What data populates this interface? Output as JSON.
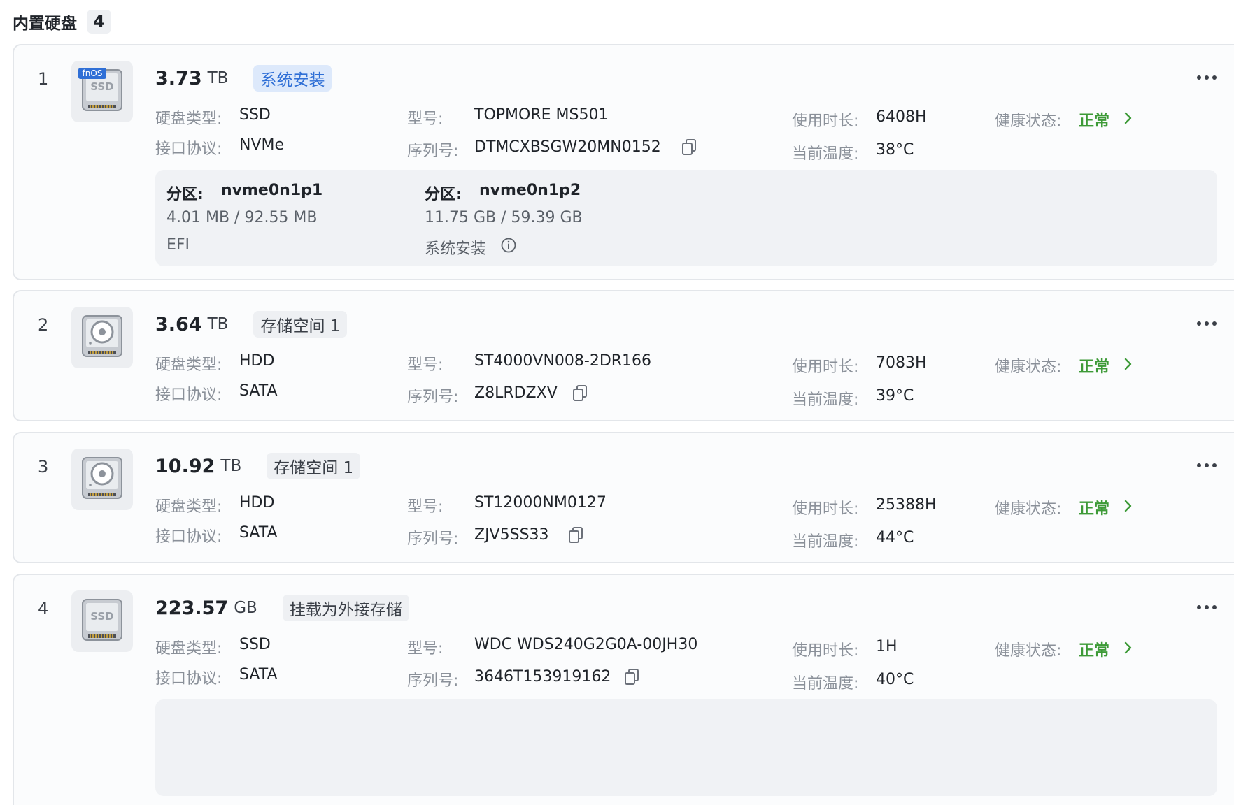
{
  "header": {
    "title": "内置硬盘",
    "count": "4"
  },
  "labels": {
    "type": "硬盘类型:",
    "protocol": "接口协议:",
    "model": "型号:",
    "serial": "序列号:",
    "usage": "使用时长:",
    "temp": "当前温度:",
    "health": "健康状态:",
    "partition": "分区:"
  },
  "colors": {
    "health_ok": "#3d9a37",
    "system_tag_bg": "#dde9fb",
    "system_tag_text": "#2f6fd6",
    "tag_bg": "#eef0f3"
  },
  "disks": [
    {
      "index": "1",
      "icon": "ssd-fnos-icon",
      "icon_ssd_text": "SSD",
      "icon_brand_text": "fnOS",
      "capacity": "3.73",
      "unit": "TB",
      "tag": "系统安装",
      "type": "SSD",
      "protocol": "NVMe",
      "model": "TOPMORE MS501",
      "serial": "DTMCXBSGW20MN0152",
      "usage": "6408H",
      "temp": "38°C",
      "health": "正常",
      "partitions": [
        {
          "name": "nvme0n1p1",
          "size": "4.01 MB / 92.55 MB",
          "role": "EFI"
        },
        {
          "name": "nvme0n1p2",
          "size": "11.75 GB / 59.39 GB",
          "role": "系统安装"
        }
      ]
    },
    {
      "index": "2",
      "icon": "hdd-icon",
      "capacity": "3.64",
      "unit": "TB",
      "tag": "存储空间 1",
      "type": "HDD",
      "protocol": "SATA",
      "model": "ST4000VN008-2DR166",
      "serial": "Z8LRDZXV",
      "usage": "7083H",
      "temp": "39°C",
      "health": "正常"
    },
    {
      "index": "3",
      "icon": "hdd-icon",
      "capacity": "10.92",
      "unit": "TB",
      "tag": "存储空间 1",
      "type": "HDD",
      "protocol": "SATA",
      "model": "ST12000NM0127",
      "serial": "ZJV5SS33",
      "usage": "25388H",
      "temp": "44°C",
      "health": "正常"
    },
    {
      "index": "4",
      "icon": "ssd-icon",
      "icon_ssd_text": "SSD",
      "capacity": "223.57",
      "unit": "GB",
      "tag": "挂载为外接存储",
      "type": "SSD",
      "protocol": "SATA",
      "model": "WDC WDS240G2G0A-00JH30",
      "serial": "3646T153919162",
      "usage": "1H",
      "temp": "40°C",
      "health": "正常"
    }
  ]
}
